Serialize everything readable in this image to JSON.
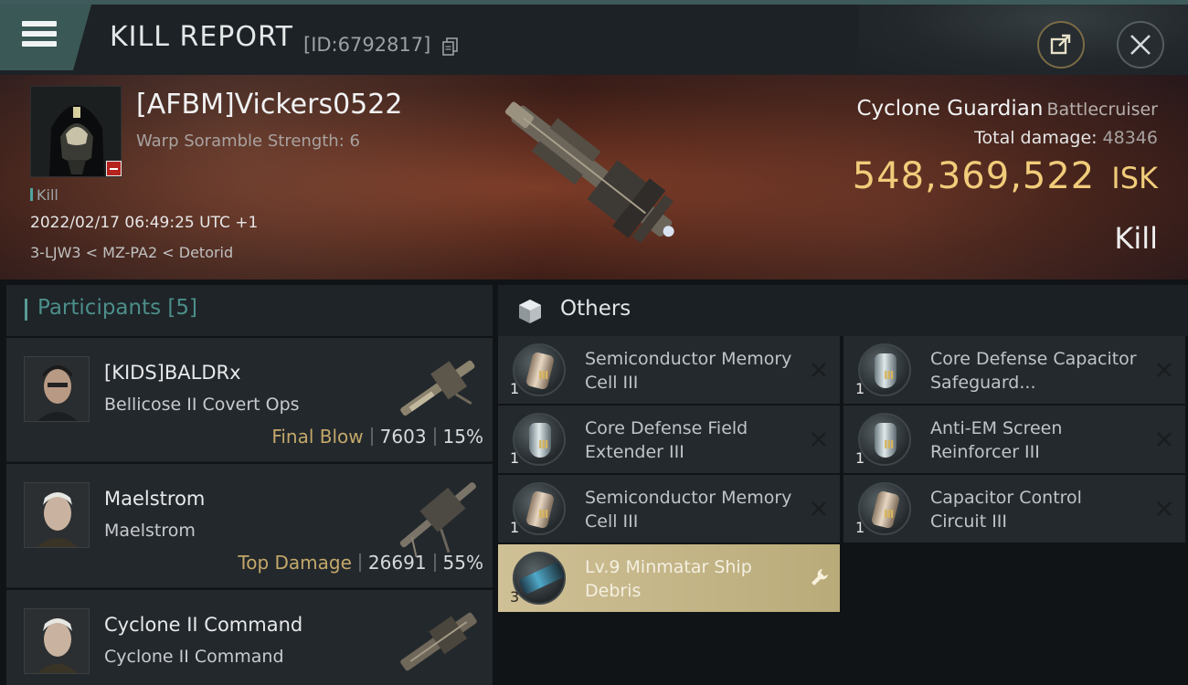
{
  "header": {
    "title": "KILL REPORT",
    "kill_id": "[ID:6792817]"
  },
  "victim": {
    "name": "[AFBM]Vickers0522",
    "warp_scramble": "Warp Soramble Strength: 6",
    "tag": "Kill",
    "datetime": "2022/02/17 06:49:25 UTC +1",
    "location": "3-LJW3 < MZ-PA2 < Detorid",
    "ship_name": "Cyclone Guardian",
    "ship_class": "Battlecruiser",
    "total_damage_label": "Total damage:",
    "total_damage_value": "48346",
    "isk_value": "548,369,522",
    "isk_unit": "ISK",
    "result": "Kill"
  },
  "participants": {
    "label": "Participants",
    "count": "[5]",
    "rows": [
      {
        "name": "[KIDS]BALDRx",
        "ship": "Bellicose II Covert Ops",
        "tag": "Final Blow",
        "damage": "7603",
        "percent": "15%"
      },
      {
        "name": "Maelstrom",
        "ship": "Maelstrom",
        "tag": "Top Damage",
        "damage": "26691",
        "percent": "55%"
      },
      {
        "name": "Cyclone II Command",
        "ship": "Cyclone II Command"
      }
    ]
  },
  "others": {
    "label": "Others",
    "items": [
      {
        "name": "Semiconductor Memory Cell III",
        "qty": "1",
        "tier": "III",
        "icon": "memory-cell-icon"
      },
      {
        "name": "Core Defense Capacitor Safeguard...",
        "qty": "1",
        "tier": "III",
        "icon": "shield-module-icon"
      },
      {
        "name": "Core Defense Field Extender III",
        "qty": "1",
        "tier": "III",
        "icon": "shield-module-icon"
      },
      {
        "name": "Anti-EM Screen Reinforcer III",
        "qty": "1",
        "tier": "III",
        "icon": "shield-module-icon"
      },
      {
        "name": "Semiconductor Memory Cell III",
        "qty": "1",
        "tier": "III",
        "icon": "memory-cell-icon"
      },
      {
        "name": "Capacitor Control Circuit III",
        "qty": "1",
        "tier": "III",
        "icon": "memory-cell-icon"
      },
      {
        "name": "Lv.9 Minmatar Ship Debris",
        "qty": "3",
        "icon": "ship-debris-icon"
      }
    ]
  },
  "colors": {
    "accent_teal": "#4c8e8a",
    "isk_gold": "#f1cc7a",
    "tag_gold": "#c3a86a",
    "highlight_item": "#c7b98a",
    "destroyed_badge": "#b6221e"
  }
}
